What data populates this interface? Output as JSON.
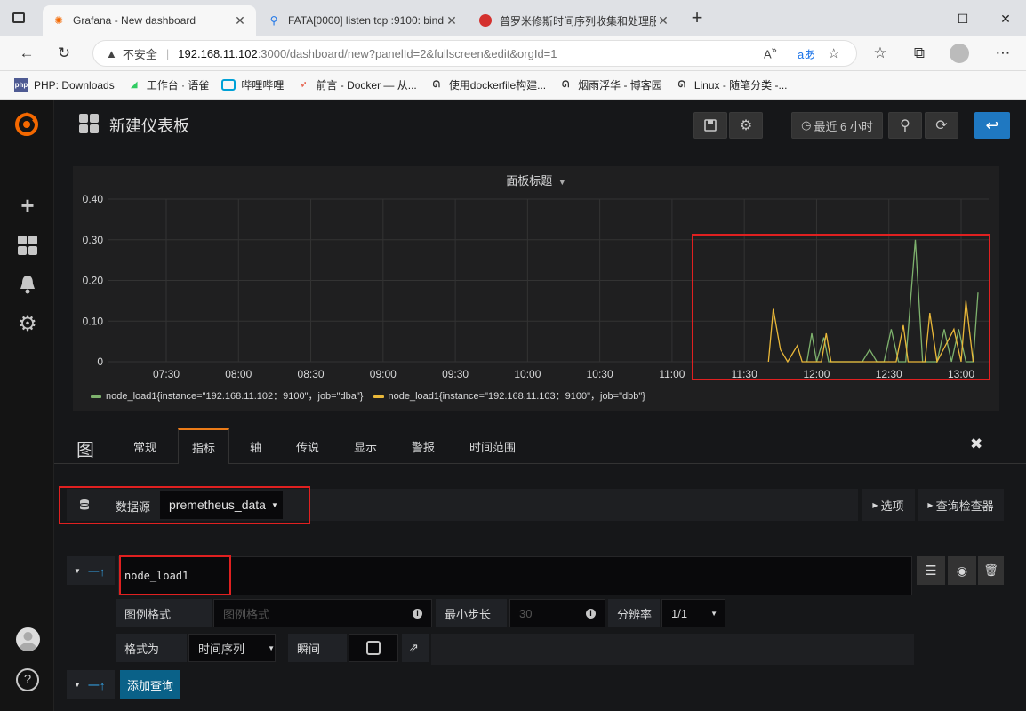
{
  "browser": {
    "tabs": [
      {
        "label": "Grafana - New dashboard",
        "icon": "grafana-icon",
        "active": true
      },
      {
        "label": "FATA[0000] listen tcp :9100: bind",
        "icon": "search-icon",
        "active": false
      },
      {
        "label": "普罗米修斯时间序列收集和处理服",
        "icon": "web-icon",
        "active": false
      }
    ],
    "new_tab": "+",
    "security_label": "不安全",
    "url_host": "192.168.11.102",
    "url_rest": ":3000/dashboard/new?panelId=2&fullscreen&edit&orgId=1",
    "bookmarks": [
      {
        "label": "PHP: Downloads",
        "icon_text": "php"
      },
      {
        "label": "工作台 · 语雀",
        "icon_text": ""
      },
      {
        "label": "哔哩哔哩",
        "icon_text": ""
      },
      {
        "label": "前言 - Docker — 从...",
        "icon_text": ""
      },
      {
        "label": "使用dockerfile构建...",
        "icon_text": ""
      },
      {
        "label": "烟雨浮华 - 博客园",
        "icon_text": ""
      },
      {
        "label": "Linux - 随笔分类 -...",
        "icon_text": ""
      }
    ]
  },
  "grafana": {
    "dashboard_title": "新建仪表板",
    "time_range_label": "最近 6 小时",
    "panel_title": "面板标题",
    "editor": {
      "viz_label": "图",
      "tabs": [
        "常规",
        "指标",
        "轴",
        "传说",
        "显示",
        "警报",
        "时间范围"
      ],
      "active_tab": "指标",
      "datasource_label": "数据源",
      "datasource_value": "premetheus_data",
      "options_button": "选项",
      "query_inspector_button": "查询检查器",
      "query_text": "node_load1",
      "legend_format_label": "图例格式",
      "legend_format_placeholder": "图例格式",
      "min_step_label": "最小步长",
      "min_step_placeholder": "30",
      "resolution_label": "分辨率",
      "resolution_value": "1/1",
      "format_as_label": "格式为",
      "format_as_value": "时间序列",
      "instant_label": "瞬间",
      "add_query_label": "添加查询"
    }
  },
  "chart_data": {
    "type": "line",
    "title": "面板标题",
    "ylim": [
      0,
      0.4
    ],
    "y_ticks": [
      "0",
      "0.10",
      "0.20",
      "0.30",
      "0.40"
    ],
    "x_ticks": [
      "07:30",
      "08:00",
      "08:30",
      "09:00",
      "09:30",
      "10:00",
      "10:30",
      "11:00",
      "11:30",
      "12:00",
      "12:30",
      "13:00"
    ],
    "grid": true,
    "legend_position": "bottom",
    "series": [
      {
        "name": "node_load1{instance=\"192.168.11.102：9100\"，job=\"dba\"}",
        "color": "#7eb26d",
        "points": [
          [
            "11:56",
            0
          ],
          [
            "11:58",
            0.07
          ],
          [
            "12:00",
            0
          ],
          [
            "12:03",
            0.06
          ],
          [
            "12:05",
            0
          ],
          [
            "12:10",
            0
          ],
          [
            "12:19",
            0
          ],
          [
            "12:22",
            0.03
          ],
          [
            "12:25",
            0
          ],
          [
            "12:28",
            0
          ],
          [
            "12:31",
            0.08
          ],
          [
            "12:34",
            0
          ],
          [
            "12:37",
            0
          ],
          [
            "12:41",
            0.3
          ],
          [
            "12:44",
            0
          ],
          [
            "12:50",
            0
          ],
          [
            "12:53",
            0.08
          ],
          [
            "12:56",
            0
          ],
          [
            "12:59",
            0.08
          ],
          [
            "13:02",
            0
          ],
          [
            "13:05",
            0
          ],
          [
            "13:07",
            0.17
          ]
        ]
      },
      {
        "name": "node_load1{instance=\"192.168.11.103：9100\"，job=\"dbb\"}",
        "color": "#eab839",
        "points": [
          [
            "11:40",
            0
          ],
          [
            "11:42",
            0.13
          ],
          [
            "11:45",
            0.03
          ],
          [
            "11:48",
            0
          ],
          [
            "11:52",
            0.04
          ],
          [
            "11:54",
            0
          ],
          [
            "12:02",
            0
          ],
          [
            "12:04",
            0.07
          ],
          [
            "12:06",
            0
          ],
          [
            "12:10",
            0
          ],
          [
            "12:33",
            0
          ],
          [
            "12:36",
            0.09
          ],
          [
            "12:38",
            0
          ],
          [
            "12:45",
            0
          ],
          [
            "12:47",
            0.12
          ],
          [
            "12:50",
            0
          ],
          [
            "12:57",
            0.08
          ],
          [
            "13:00",
            0
          ],
          [
            "13:02",
            0.15
          ],
          [
            "13:05",
            0
          ]
        ]
      }
    ]
  }
}
